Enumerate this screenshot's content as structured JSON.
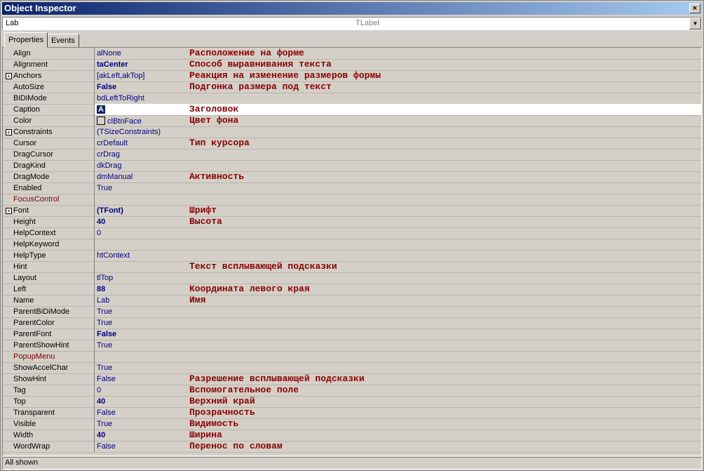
{
  "window": {
    "title": "Object Inspector",
    "close_glyph": "×"
  },
  "selector": {
    "value": "Lab",
    "type": "TLabel",
    "dropdown_glyph": "▼"
  },
  "tabs": [
    {
      "label": "Properties"
    },
    {
      "label": "Events"
    }
  ],
  "rows": [
    {
      "name": "Align",
      "value": "alNone",
      "note": "Расположение на форме"
    },
    {
      "name": "Alignment",
      "value": "taCenter",
      "note": "Способ выравнивания текста"
    },
    {
      "name": "Anchors",
      "value": "[akLeft,akTop]",
      "note": "Реакция на изменение размеров формы"
    },
    {
      "name": "AutoSize",
      "value": "False",
      "note": "Подгонка размера под текст"
    },
    {
      "name": "BiDiMode",
      "value": "bdLeftToRight",
      "note": ""
    },
    {
      "name": "Caption",
      "value": "A",
      "note": "Заголовок"
    },
    {
      "name": "Color",
      "value": "clBtnFace",
      "note": "Цвет фона"
    },
    {
      "name": "Constraints",
      "value": "(TSizeConstraints)",
      "note": ""
    },
    {
      "name": "Cursor",
      "value": "crDefault",
      "note": "Тип курсора"
    },
    {
      "name": "DragCursor",
      "value": "crDrag",
      "note": ""
    },
    {
      "name": "DragKind",
      "value": "dkDrag",
      "note": ""
    },
    {
      "name": "DragMode",
      "value": "dmManual",
      "note": "Активность"
    },
    {
      "name": "Enabled",
      "value": "True",
      "note": ""
    },
    {
      "name": "FocusControl",
      "value": "",
      "note": ""
    },
    {
      "name": "Font",
      "value": "(TFont)",
      "note": "Шрифт"
    },
    {
      "name": "Height",
      "value": "40",
      "note": "Высота"
    },
    {
      "name": "HelpContext",
      "value": "0",
      "note": ""
    },
    {
      "name": "HelpKeyword",
      "value": "",
      "note": ""
    },
    {
      "name": "HelpType",
      "value": "htContext",
      "note": ""
    },
    {
      "name": "Hint",
      "value": "",
      "note": "Текст всплывающей подсказки"
    },
    {
      "name": "Layout",
      "value": "tlTop",
      "note": ""
    },
    {
      "name": "Left",
      "value": "88",
      "note": "Координата левого края"
    },
    {
      "name": "Name",
      "value": "Lab",
      "note": "Имя"
    },
    {
      "name": "ParentBiDiMode",
      "value": "True",
      "note": ""
    },
    {
      "name": "ParentColor",
      "value": "True",
      "note": ""
    },
    {
      "name": "ParentFont",
      "value": "False",
      "note": ""
    },
    {
      "name": "ParentShowHint",
      "value": "True",
      "note": ""
    },
    {
      "name": "PopupMenu",
      "value": "",
      "note": ""
    },
    {
      "name": "ShowAccelChar",
      "value": "True",
      "note": ""
    },
    {
      "name": "ShowHint",
      "value": "False",
      "note": "Разрешение всплывающей подсказки"
    },
    {
      "name": "Tag",
      "value": "0",
      "note": "Вспомогательное поле"
    },
    {
      "name": "Top",
      "value": "40",
      "note": "Верхний край"
    },
    {
      "name": "Transparent",
      "value": "False",
      "note": "Прозрачность"
    },
    {
      "name": "Visible",
      "value": "True",
      "note": "Видимость"
    },
    {
      "name": "Width",
      "value": "40",
      "note": "Ширина"
    },
    {
      "name": "WordWrap",
      "value": "False",
      "note": "Перенос по словам"
    }
  ],
  "status": "All shown"
}
